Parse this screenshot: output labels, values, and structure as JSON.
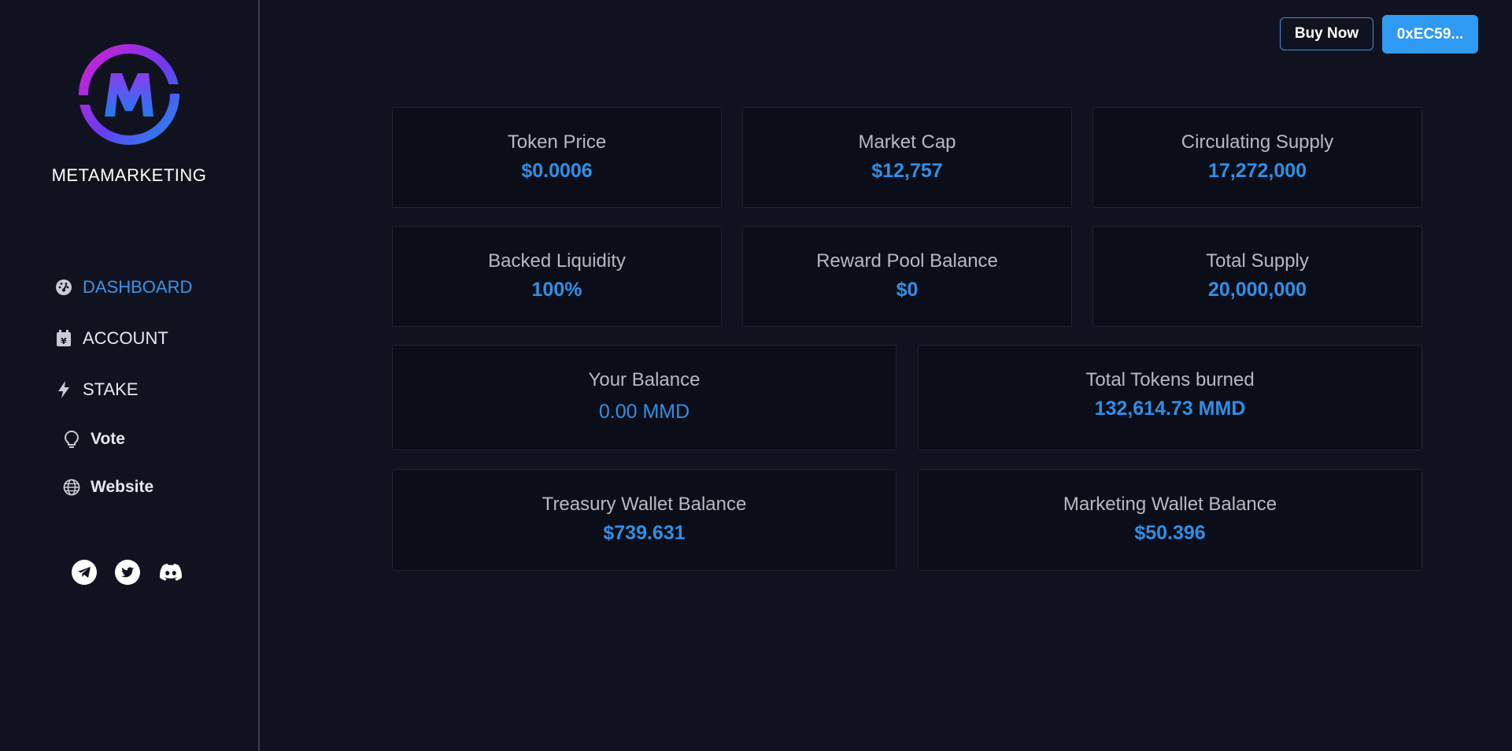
{
  "sidebar": {
    "brand": "METAMARKETING",
    "nav": {
      "dashboard": "DASHBOARD",
      "account": "ACCOUNT",
      "stake": "STAKE",
      "vote": "Vote",
      "website": "Website"
    }
  },
  "header": {
    "buy_label": "Buy Now",
    "wallet_label": "0xEC59..."
  },
  "stats": {
    "token_price": {
      "label": "Token Price",
      "value": "$0.0006"
    },
    "market_cap": {
      "label": "Market Cap",
      "value": "$12,757"
    },
    "circulating_supply": {
      "label": "Circulating Supply",
      "value": "17,272,000"
    },
    "backed_liquidity": {
      "label": "Backed Liquidity",
      "value": "100%"
    },
    "reward_pool_balance": {
      "label": "Reward Pool Balance",
      "value": "$0"
    },
    "total_supply": {
      "label": "Total Supply",
      "value": "20,000,000"
    },
    "your_balance": {
      "label": "Your Balance",
      "value": "0.00 MMD"
    },
    "total_tokens_burned": {
      "label": "Total Tokens burned",
      "value": "132,614.73 MMD"
    },
    "treasury_wallet_balance": {
      "label": "Treasury Wallet Balance",
      "value": "$739.631"
    },
    "marketing_wallet_balance": {
      "label": "Marketing Wallet Balance",
      "value": "$50.396"
    }
  },
  "colors": {
    "background": "#10131f",
    "card": "#0b0e18",
    "accent": "#2f8fe8",
    "wallet_button": "#2f9af2"
  }
}
